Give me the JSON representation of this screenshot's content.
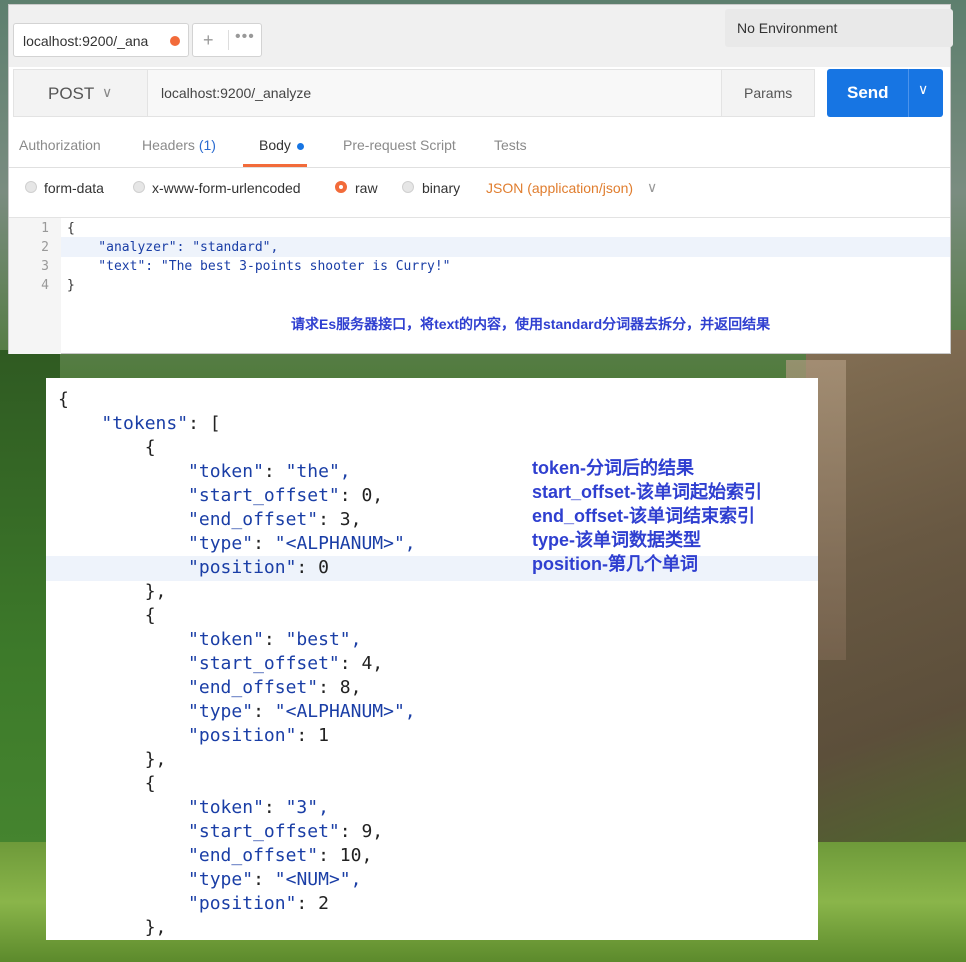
{
  "tab": {
    "label": "localhost:9200/_ana",
    "plus": "+",
    "more": "•••"
  },
  "environment": {
    "label": "No Environment"
  },
  "request": {
    "method": "POST",
    "url": "localhost:9200/_analyze",
    "params_label": "Params",
    "send_label": "Send"
  },
  "subtabs": {
    "authorization": "Authorization",
    "headers": "Headers",
    "headers_count": "(1)",
    "body": "Body",
    "prerequest": "Pre-request Script",
    "tests": "Tests"
  },
  "body_options": {
    "form_data": "form-data",
    "urlencoded": "x-www-form-urlencoded",
    "raw": "raw",
    "binary": "binary",
    "content_type": "JSON (application/json)",
    "selected": "raw"
  },
  "editor": {
    "line_numbers": [
      "1",
      "2",
      "3",
      "4"
    ],
    "lines": [
      "{",
      "    \"analyzer\": \"standard\",",
      "    \"text\": \"The best 3-points shooter is Curry!\"",
      "}"
    ]
  },
  "note_request": "请求Es服务器接口，将text的内容，使用standard分词器去拆分，并返回结果",
  "response_lines": [
    "{",
    "    \"tokens\": [",
    "        {",
    "            \"token\": \"the\",",
    "            \"start_offset\": 0,",
    "            \"end_offset\": 3,",
    "            \"type\": \"<ALPHANUM>\",",
    "            \"position\": 0",
    "        },",
    "        {",
    "            \"token\": \"best\",",
    "            \"start_offset\": 4,",
    "            \"end_offset\": 8,",
    "            \"type\": \"<ALPHANUM>\",",
    "            \"position\": 1",
    "        },",
    "        {",
    "            \"token\": \"3\",",
    "            \"start_offset\": 9,",
    "            \"end_offset\": 10,",
    "            \"type\": \"<NUM>\",",
    "            \"position\": 2",
    "        },"
  ],
  "annotations": [
    "token-分词后的结果",
    "start_offset-该单词起始索引",
    "end_offset-该单词结束索引",
    "type-该单词数据类型",
    "position-第几个单词"
  ],
  "colors": {
    "accent": "#1775e3",
    "orange": "#f26b3a",
    "annotation": "#2f3fd0"
  }
}
